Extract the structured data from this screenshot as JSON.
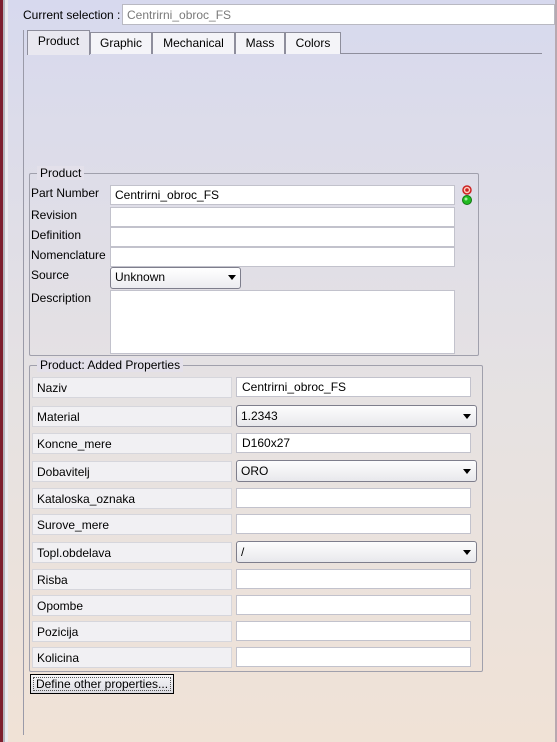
{
  "selection": {
    "label": "Current selection :",
    "value": "Centrirni_obroc_FS"
  },
  "tabs": [
    {
      "label": "Product",
      "active": true
    },
    {
      "label": "Graphic",
      "active": false
    },
    {
      "label": "Mechanical",
      "active": false
    },
    {
      "label": "Mass",
      "active": false
    },
    {
      "label": "Colors",
      "active": false
    }
  ],
  "product": {
    "title": "Product",
    "part_number_label": "Part Number",
    "part_number": "Centrirni_obroc_FS",
    "revision_label": "Revision",
    "revision": "",
    "definition_label": "Definition",
    "definition": "",
    "nomenclature_label": "Nomenclature",
    "nomenclature": "",
    "source_label": "Source",
    "source": "Unknown",
    "description_label": "Description",
    "description": ""
  },
  "added": {
    "title": "Product: Added Properties",
    "rows": [
      {
        "label": "Naziv",
        "value": "Centrirni_obroc_FS",
        "type": "text"
      },
      {
        "label": "Material",
        "value": "1.2343",
        "type": "combo"
      },
      {
        "label": "Koncne_mere",
        "value": "D160x27",
        "type": "text"
      },
      {
        "label": "Dobavitelj",
        "value": "ORO",
        "type": "combo"
      },
      {
        "label": "Kataloska_oznaka",
        "value": "",
        "type": "text"
      },
      {
        "label": "Surove_mere",
        "value": "",
        "type": "text"
      },
      {
        "label": "Topl.obdelava",
        "value": "/",
        "type": "combo"
      },
      {
        "label": "Risba",
        "value": "",
        "type": "text"
      },
      {
        "label": "Opombe",
        "value": "",
        "type": "text"
      },
      {
        "label": "Pozicija",
        "value": "",
        "type": "text"
      },
      {
        "label": "Kolicina",
        "value": "",
        "type": "text"
      }
    ]
  },
  "define_button": "Define other properties...",
  "colors": {
    "status_green": "#22bb22",
    "status_red": "#cc2222"
  },
  "icons": {
    "status": "traffic-light-icon",
    "dropdown": "chevron-down-icon"
  }
}
